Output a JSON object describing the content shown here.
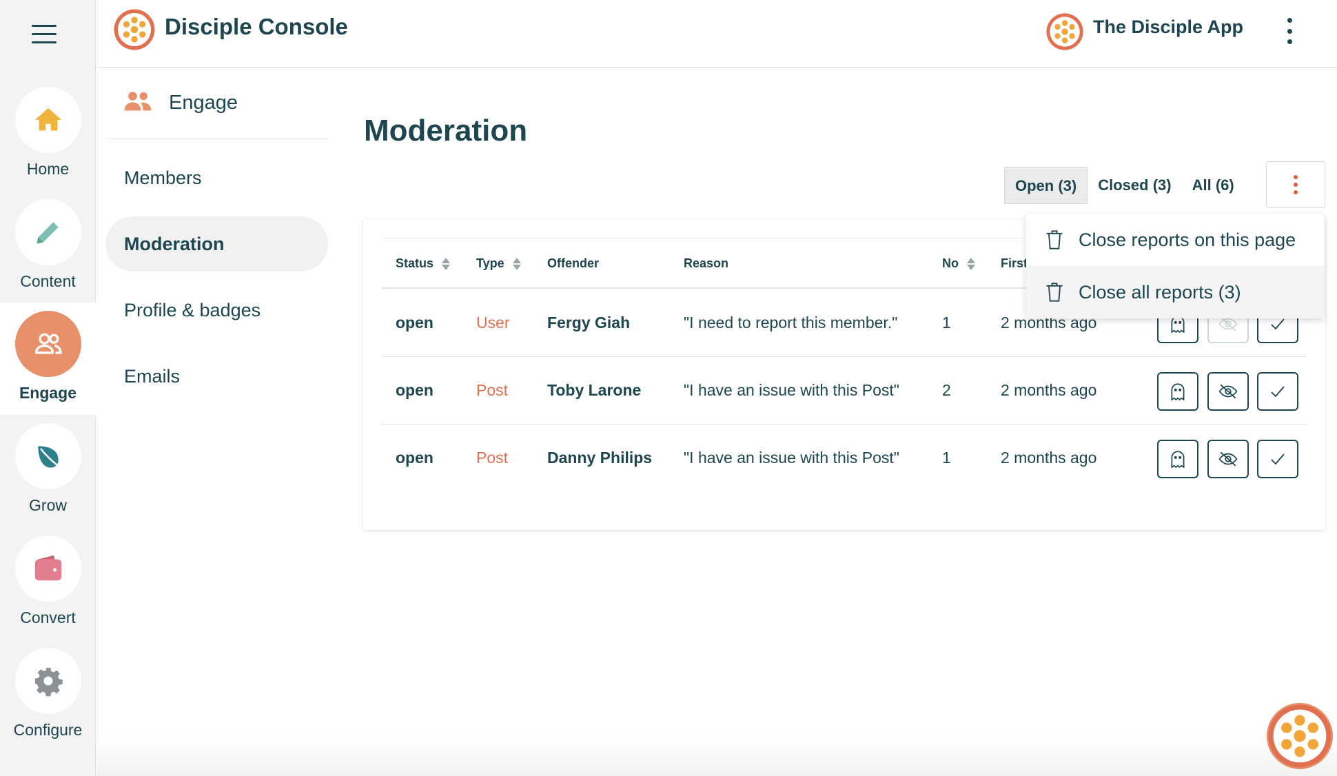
{
  "colors": {
    "primary": "#1e4650",
    "accent": "#e8906a",
    "danger": "#e05c3a",
    "type_text": "#e07050"
  },
  "rail": {
    "menu_icon": "hamburger-icon",
    "items": [
      {
        "label": "Home",
        "icon": "home-icon",
        "active": false
      },
      {
        "label": "Content",
        "icon": "pencil-icon",
        "active": false
      },
      {
        "label": "Engage",
        "icon": "people-icon",
        "active": true
      },
      {
        "label": "Grow",
        "icon": "leaf-icon",
        "active": false
      },
      {
        "label": "Convert",
        "icon": "wallet-icon",
        "active": false
      },
      {
        "label": "Configure",
        "icon": "gear-icon",
        "active": false
      }
    ]
  },
  "header": {
    "title": "Disciple Console",
    "app_name": "The Disciple App"
  },
  "subnav": {
    "title": "Engage",
    "items": [
      {
        "label": "Members",
        "active": false
      },
      {
        "label": "Moderation",
        "active": true
      },
      {
        "label": "Profile & badges",
        "active": false
      },
      {
        "label": "Emails",
        "active": false
      }
    ]
  },
  "main": {
    "title": "Moderation",
    "tabs": [
      {
        "label": "Open (3)",
        "active": true
      },
      {
        "label": "Closed (3)",
        "active": false
      },
      {
        "label": "All (6)",
        "active": false
      }
    ],
    "table": {
      "columns": [
        "Status",
        "Type",
        "Offender",
        "Reason",
        "No",
        "First"
      ],
      "rows": [
        {
          "status": "open",
          "type": "User",
          "offender": "Fergy Giah",
          "reason": "\"I need to report this member.\"",
          "no": "1",
          "first": "2 months ago"
        },
        {
          "status": "open",
          "type": "Post",
          "offender": "Toby Larone",
          "reason": "\"I have an issue with this Post\"",
          "no": "2",
          "first": "2 months ago"
        },
        {
          "status": "open",
          "type": "Post",
          "offender": "Danny Philips",
          "reason": "\"I have an issue with this Post\"",
          "no": "1",
          "first": "2 months ago"
        }
      ]
    },
    "menu": {
      "items": [
        {
          "label": "Close reports on this page",
          "icon": "trash-icon"
        },
        {
          "label": "Close all reports (3)",
          "icon": "trash-icon"
        }
      ]
    }
  }
}
